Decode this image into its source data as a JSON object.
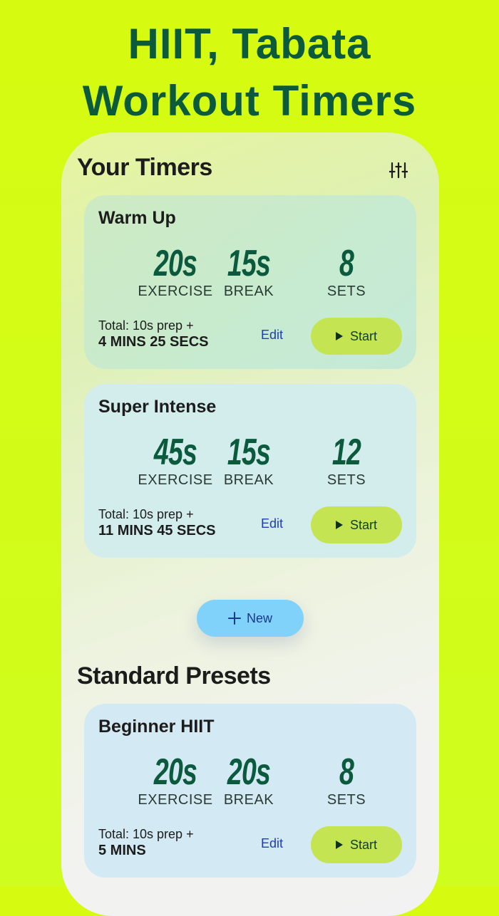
{
  "headline": {
    "line1": "HIIT, Tabata",
    "line2": "Workout Timers"
  },
  "your_timers": {
    "title": "Your Timers",
    "cards": [
      {
        "name": "Warm Up",
        "exercise": "20s",
        "break": "15s",
        "sets": "8",
        "total_prep": "Total: 10s prep +",
        "total_duration": "4 MINS 25 SECS"
      },
      {
        "name": "Super Intense",
        "exercise": "45s",
        "break": "15s",
        "sets": "12",
        "total_prep": "Total: 10s prep +",
        "total_duration": "11 MINS 45 SECS"
      }
    ]
  },
  "labels": {
    "exercise": "EXERCISE",
    "break": "BREAK",
    "sets": "SETS",
    "edit": "Edit",
    "start": "Start",
    "new": "New"
  },
  "standard_presets": {
    "title": "Standard Presets",
    "cards": [
      {
        "name": "Beginner HIIT",
        "exercise": "20s",
        "break": "20s",
        "sets": "8",
        "total_prep": "Total: 10s prep +",
        "total_duration": "5 MINS"
      }
    ]
  },
  "colors": {
    "background": "#d6fb10",
    "headline": "#0b5a3c",
    "start_button": "#c5e452",
    "new_button": "#80d2fb",
    "edit_link": "#1e3fb2"
  },
  "icons": {
    "filter": "sliders-icon",
    "start": "play-icon",
    "new": "plus-icon"
  }
}
